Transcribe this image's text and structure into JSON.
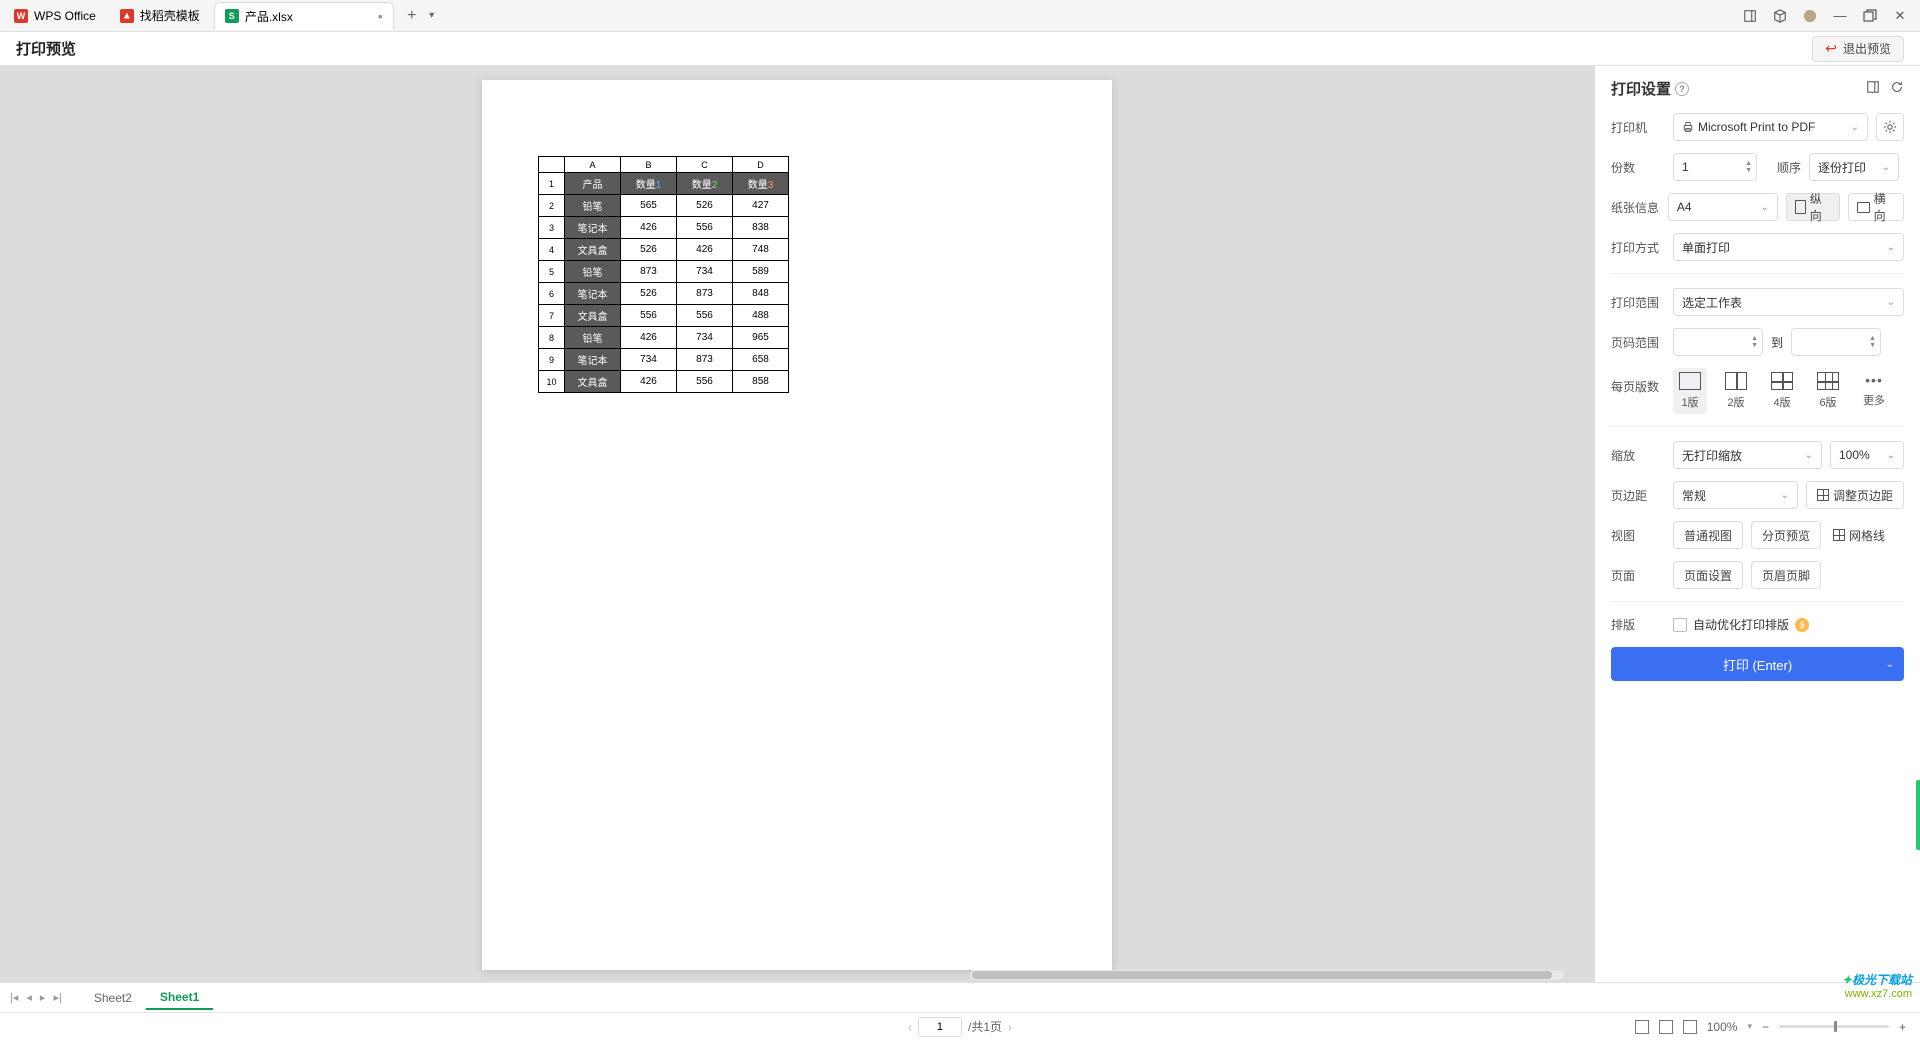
{
  "titlebar": {
    "app_tab": "WPS Office",
    "template_tab": "找稻壳模板",
    "file_tab": "产品.xlsx"
  },
  "header": {
    "title": "打印预览",
    "exit": "退出预览"
  },
  "panel": {
    "title": "打印设置",
    "printer_label": "打印机",
    "printer_value": "Microsoft Print to PDF",
    "copies_label": "份数",
    "copies_value": "1",
    "order_label": "顺序",
    "order_value": "逐份打印",
    "paper_label": "纸张信息",
    "paper_value": "A4",
    "portrait": "纵向",
    "landscape": "横向",
    "mode_label": "打印方式",
    "mode_value": "单面打印",
    "range_label": "打印范围",
    "range_value": "选定工作表",
    "page_range_label": "页码范围",
    "page_to": "到",
    "layout_label": "每页版数",
    "layout_1": "1版",
    "layout_2": "2版",
    "layout_4": "4版",
    "layout_6": "6版",
    "layout_more": "更多",
    "scale_label": "缩放",
    "scale_value": "无打印缩放",
    "scale_pct": "100%",
    "margin_label": "页边距",
    "margin_value": "常规",
    "margin_btn": "调整页边距",
    "view_label": "视图",
    "view_normal": "普通视图",
    "view_page": "分页预览",
    "gridlines": "网格线",
    "page_label": "页面",
    "page_setup": "页面设置",
    "header_footer": "页眉页脚",
    "typeset_label": "排版",
    "auto_typeset": "自动优化打印排版",
    "print_btn": "打印 (Enter)"
  },
  "sheets": {
    "s1": "Sheet2",
    "s2": "Sheet1"
  },
  "status": {
    "page_current": "1",
    "page_total": "/共1页",
    "zoom": "100%"
  },
  "watermark": {
    "l1": "极光下载站",
    "l2": "www.xz7.com"
  },
  "chart_data": {
    "type": "table",
    "columns": [
      "A",
      "B",
      "C",
      "D"
    ],
    "header_row": [
      "产品",
      "数量1",
      "数量2",
      "数量3"
    ],
    "rows": [
      {
        "n": "1",
        "name": "产品",
        "b": "数量1",
        "c": "数量2",
        "d": "数量3"
      },
      {
        "n": "2",
        "name": "铅笔",
        "b": "565",
        "c": "526",
        "d": "427"
      },
      {
        "n": "3",
        "name": "笔记本",
        "b": "426",
        "c": "556",
        "d": "838"
      },
      {
        "n": "4",
        "name": "文具盒",
        "b": "526",
        "c": "426",
        "d": "748"
      },
      {
        "n": "5",
        "name": "铅笔",
        "b": "873",
        "c": "734",
        "d": "589"
      },
      {
        "n": "6",
        "name": "笔记本",
        "b": "526",
        "c": "873",
        "d": "848"
      },
      {
        "n": "7",
        "name": "文具盒",
        "b": "556",
        "c": "556",
        "d": "488"
      },
      {
        "n": "8",
        "name": "铅笔",
        "b": "426",
        "c": "734",
        "d": "965"
      },
      {
        "n": "9",
        "name": "笔记本",
        "b": "734",
        "c": "873",
        "d": "658"
      },
      {
        "n": "10",
        "name": "文具盒",
        "b": "426",
        "c": "556",
        "d": "858"
      }
    ]
  }
}
